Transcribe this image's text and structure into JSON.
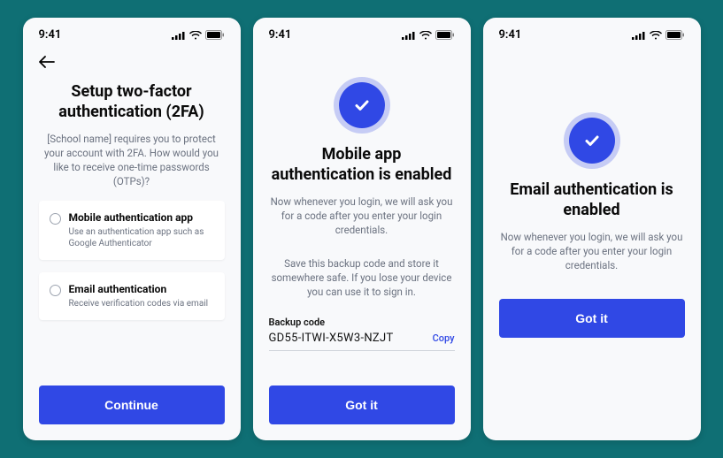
{
  "status": {
    "time": "9:41"
  },
  "screen1": {
    "title": "Setup two-factor authentication (2FA)",
    "subtitle": "[School name] requires you to protect your account with 2FA. How would you like to receive one-time passwords (OTPs)?",
    "options": [
      {
        "title": "Mobile authentication app",
        "desc": "Use an authentication app such as Google Authenticator"
      },
      {
        "title": "Email authentication",
        "desc": "Receive verification codes via email"
      }
    ],
    "cta": "Continue"
  },
  "screen2": {
    "title": "Mobile app authentication is enabled",
    "subtitle1": "Now whenever you login, we will ask you for a code after you enter your login credentials.",
    "subtitle2": "Save this backup code and store it somewhere safe. If you lose your device you can use it to sign in.",
    "code_label": "Backup code",
    "code_value": "GD55-ITWI-X5W3-NZJT",
    "copy": "Copy",
    "cta": "Got it"
  },
  "screen3": {
    "title": "Email authentication is enabled",
    "subtitle": "Now whenever you login, we will ask you for a code after you enter your login credentials.",
    "cta": "Got it"
  }
}
